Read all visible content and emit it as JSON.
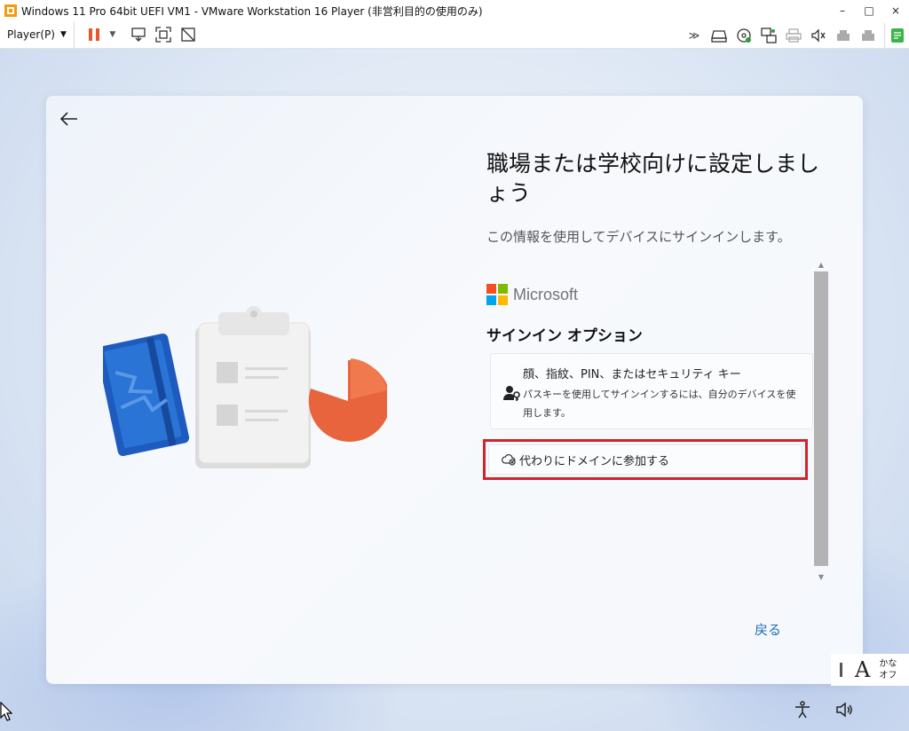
{
  "window": {
    "title": "Windows 11 Pro 64bit UEFI VM1 - VMware Workstation 16 Player (非営利目的の使用のみ)",
    "minimize_label": "–",
    "maximize_label": "□",
    "close_label": "×",
    "accent_color": "#f39c12"
  },
  "toolbar": {
    "player_menu_label": "Player(P)",
    "pause_color": "#e8562a"
  },
  "oobe": {
    "heading": "職場または学校向けに設定しましょう",
    "subtitle": "この情報を使用してデバイスにサインインします。",
    "brand": "Microsoft",
    "signin_options_heading": "サインイン オプション",
    "security_key_option": {
      "title": "顔、指紋、PIN、またはセキュリティ キー",
      "description": "パスキーを使用してサインインするには、自分のデバイスを使用します。"
    },
    "domain_join_option": "代わりにドメインに参加する",
    "back_link": "戻る",
    "highlight_color": "#d2232a"
  },
  "ime": {
    "mode_letter": "A",
    "kana_line1": "かな",
    "kana_line2": "オフ"
  }
}
